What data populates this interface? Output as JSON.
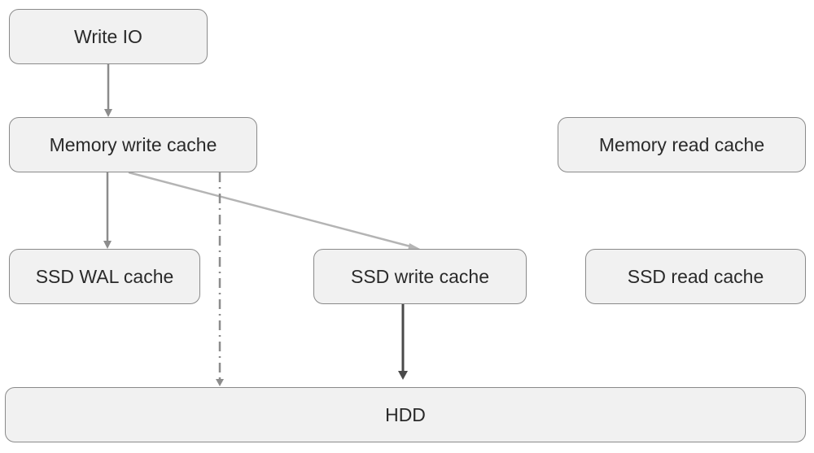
{
  "diagram": {
    "nodes": [
      {
        "id": "write_io",
        "label": "Write IO"
      },
      {
        "id": "memory_write_cache",
        "label": "Memory write cache"
      },
      {
        "id": "memory_read_cache",
        "label": "Memory read cache"
      },
      {
        "id": "ssd_wal_cache",
        "label": "SSD WAL cache"
      },
      {
        "id": "ssd_write_cache",
        "label": "SSD write cache"
      },
      {
        "id": "ssd_read_cache",
        "label": "SSD read cache"
      },
      {
        "id": "hdd",
        "label": "HDD"
      }
    ],
    "edges": [
      {
        "from": "write_io",
        "to": "memory_write_cache",
        "style": "solid",
        "color": "#8c8c8c"
      },
      {
        "from": "memory_write_cache",
        "to": "ssd_wal_cache",
        "style": "solid",
        "color": "#8c8c8c"
      },
      {
        "from": "memory_write_cache",
        "to": "ssd_write_cache",
        "style": "solid",
        "color": "#b4b4b4"
      },
      {
        "from": "memory_write_cache",
        "to": "hdd",
        "style": "dash-dot",
        "color": "#8c8c8c"
      },
      {
        "from": "ssd_write_cache",
        "to": "hdd",
        "style": "solid",
        "color": "#4a4a4a"
      }
    ]
  }
}
